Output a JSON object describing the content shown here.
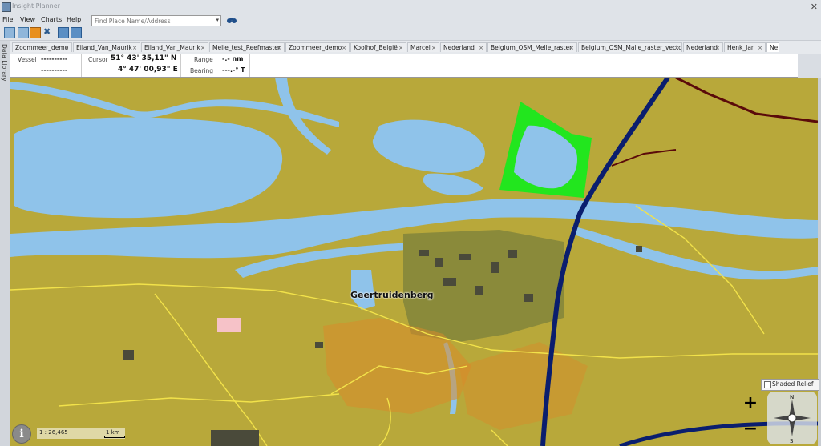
{
  "window": {
    "title": "Insight Planner",
    "close_glyph": "✕"
  },
  "menu": [
    "File",
    "View",
    "Charts",
    "Help"
  ],
  "search": {
    "placeholder": "Find Place Name/Address",
    "value": "",
    "dropdown_glyph": "▾"
  },
  "toolbar_icons": [
    "list-icon",
    "panel-icon",
    "orange-icon",
    "tools-icon",
    "doc-icon-1",
    "doc-icon-2"
  ],
  "sidebar": {
    "label": "Data Library"
  },
  "tabs": [
    {
      "label": "Zoommeer_demo"
    },
    {
      "label": "Eiland_Van_Maurik"
    },
    {
      "label": "Eiland_Van_Maurik"
    },
    {
      "label": "Melle_test_Reefmaster"
    },
    {
      "label": "Zoommeer_demo"
    },
    {
      "label": "Koolhof_België"
    },
    {
      "label": "Marcel"
    },
    {
      "label": "Nederland"
    },
    {
      "label": "Belgium_OSM_Melle_raster"
    },
    {
      "label": "Belgium_OSM_Malle_raster_vector"
    },
    {
      "label": "Nederland"
    },
    {
      "label": "Henk_Jan"
    },
    {
      "label": "Ne"
    }
  ],
  "tab_close_glyph": "×",
  "infobar": {
    "vessel_label": "Vessel",
    "vessel_line1": "----------",
    "vessel_line2": "----------",
    "cursor_label": "Cursor",
    "cursor_lat": "51° 43' 35,11\" N",
    "cursor_lon": "4° 47' 00,93\" E",
    "range_label": "Range",
    "range_value": "-.- nm",
    "bearing_label": "Bearing",
    "bearing_value": "---.-° T"
  },
  "map": {
    "place_name": "Geertruidenberg",
    "scale_ratio": "1 : 26,465",
    "scale_distance": "1 km",
    "shaded_relief_label": "Shaded Relief",
    "shaded_relief_checked": false,
    "zoom_in": "+",
    "zoom_out": "−",
    "compass_n": "N",
    "compass_s": "S",
    "info_glyph": "i",
    "colors": {
      "land": "#b8a83a",
      "water": "#8fc3ea",
      "park": "#22e61e",
      "roads_yellow": "#f2e24a",
      "urban": "#d98a2a",
      "motorway": "#0a1e6e",
      "railway": "#5a0a0a",
      "pink_area": "#f6c2c8"
    }
  }
}
